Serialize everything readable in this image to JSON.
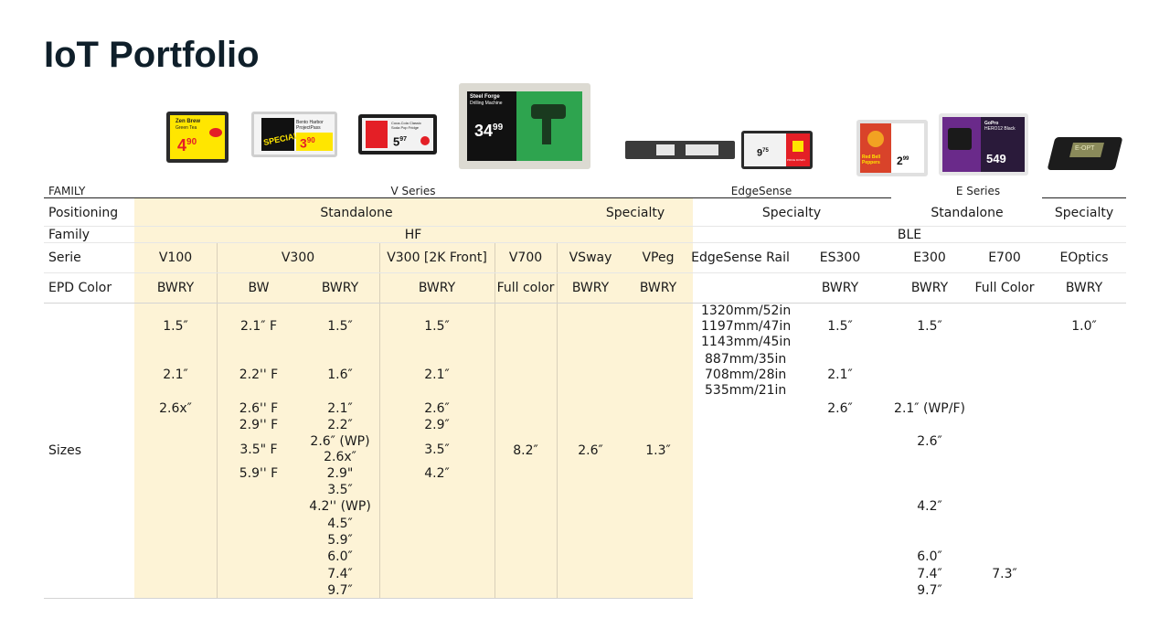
{
  "title": "IoT Portfolio",
  "row_labels": {
    "family_header": "FAMILY",
    "positioning": "Positioning",
    "family": "Family",
    "serie": "Serie",
    "epd_color": "EPD Color",
    "sizes": "Sizes"
  },
  "family_headers": {
    "v_series": "V Series",
    "edgesense": "EdgeSense",
    "e_series": "E Series"
  },
  "positioning": {
    "standalone_v": "Standalone",
    "specialty_v": "Specialty",
    "specialty_edge": "Specialty",
    "standalone_e": "Standalone",
    "specialty_eoptics": "Specialty"
  },
  "family_row": {
    "hf": "HF",
    "ble": "BLE"
  },
  "series": {
    "v100": "V100",
    "v300": "V300",
    "v300_2k": "V300 [2K Front]",
    "v700": "V700",
    "vsway": "VSway",
    "vpeg": "VPeg",
    "edgesense_rail": "EdgeSense Rail",
    "es300": "ES300",
    "e300": "E300",
    "e700": "E700",
    "eoptics": "EOptics"
  },
  "epd": {
    "v100": "BWRY",
    "v300_bw": "BW",
    "v300_bwry": "BWRY",
    "v300_2k": "BWRY",
    "v700": "Full color",
    "vsway": "BWRY",
    "vpeg": "BWRY",
    "es300": "BWRY",
    "e300": "BWRY",
    "e700": "Full Color",
    "eoptics": "BWRY"
  },
  "sizes": {
    "v100": [
      "1.5″",
      "2.1″",
      "2.6x″"
    ],
    "v300_f": [
      "2.1″ F",
      "2.2'' F",
      "2.6'' F",
      "2.9'' F",
      "3.5\" F",
      "5.9'' F"
    ],
    "v300": [
      "1.5″",
      "1.6″",
      "2.1″",
      "2.2″",
      "2.6″ (WP)",
      "2.6x″",
      "2.9\"",
      "3.5″",
      "4.2'' (WP)",
      "4.5″",
      "5.9″",
      "6.0″",
      "7.4″",
      "9.7″"
    ],
    "v300_2k": [
      "1.5″",
      "2.1″",
      "2.6″",
      "2.9″",
      "3.5″",
      "4.2″"
    ],
    "v700": [
      "8.2″"
    ],
    "vsway": [
      "2.6″"
    ],
    "vpeg": [
      "1.3″"
    ],
    "rail": [
      "1320mm/52in",
      "1197mm/47in",
      "1143mm/45in",
      "887mm/35in",
      "708mm/28in",
      "535mm/21in"
    ],
    "es300": [
      "1.5″",
      "2.1″",
      "2.6″"
    ],
    "e300": [
      "1.5″",
      "2.1″ (WP/F)",
      "2.6″",
      "4.2″",
      "6.0″",
      "7.4″",
      "9.7″"
    ],
    "e700": [
      "7.3″"
    ],
    "eoptics": [
      "1.0″"
    ]
  },
  "devices": {
    "d1": {
      "line1": "Zen Brew",
      "line2": "Green Tea",
      "price": "4",
      "cents": "90"
    },
    "d2": {
      "badge": "SPECIAL",
      "line1": "Bento Harbor",
      "line2": "ProjectPass",
      "price": "3",
      "cents": "90"
    },
    "d3": {
      "line1": "Coca-Cola Classic",
      "line2": "Soda Pop Fridge",
      "price": "5",
      "cents": "97"
    },
    "d4": {
      "line1": "Steel Forge",
      "line2": "Drilling Machine",
      "price": "34",
      "cents": "99"
    },
    "d6": {
      "price": "9",
      "cents": "75",
      "badge": "PRICE DOWN"
    },
    "d7": {
      "line1": "Red Bell Peppers",
      "price": "2",
      "cents": "99"
    },
    "d8": {
      "line1": "GoPro",
      "line2": "HERO12 Black",
      "price": "549"
    },
    "d9": {
      "label": "E-OPT"
    }
  },
  "colors": {
    "highlight": "#fdf3d6",
    "title": "#0f1f2a",
    "price_yellow": "#ffe600",
    "price_red": "#e41f26",
    "drill_green": "#2ea44f"
  }
}
